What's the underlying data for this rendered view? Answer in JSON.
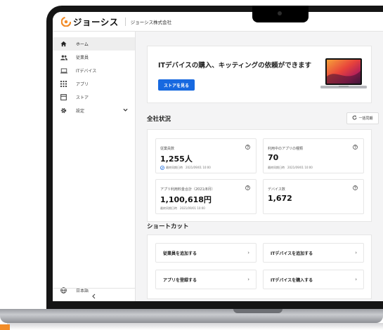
{
  "header": {
    "logo_text": "ジョーシス",
    "company_name": "ジョーシス株式会社"
  },
  "sidebar": {
    "items": [
      {
        "label": "ホーム",
        "icon": "home-icon",
        "active": true
      },
      {
        "label": "従業員",
        "icon": "people-icon"
      },
      {
        "label": "ITデバイス",
        "icon": "laptop-icon"
      },
      {
        "label": "アプリ",
        "icon": "apps-grid-icon"
      },
      {
        "label": "ストア",
        "icon": "store-icon"
      },
      {
        "label": "設定",
        "icon": "gear-icon"
      }
    ],
    "language": "日本語",
    "collapse_icon": "chevron-left-icon"
  },
  "banner": {
    "title": "ITデバイスの購入、キッティングの依頼ができます",
    "button": "ストアを見る"
  },
  "overview": {
    "title": "全社状況",
    "sync_button": "一括同期",
    "cards": [
      {
        "label": "従業員数",
        "value": "1,255人",
        "sub": "最終同期日時　2021/09/01 10:00"
      },
      {
        "label": "利用中のアプリの種類",
        "value": "70",
        "sub": "最終同期日時　2021/09/01 10:00"
      },
      {
        "label": "アプリ利用料金合計（2021/8月）",
        "value": "1,100,618円",
        "sub": "最終同期日時　2021/09/01 10:00"
      },
      {
        "label": "デバイス数",
        "value": "1,672",
        "sub": ""
      }
    ]
  },
  "shortcuts": {
    "title": "ショートカット",
    "items": [
      {
        "label": "従業員を追加する"
      },
      {
        "label": "ITデバイスを追加する"
      },
      {
        "label": "アプリを登録する"
      },
      {
        "label": "ITデバイスを購入する"
      }
    ]
  },
  "colors": {
    "accent": "#1769e0",
    "logo_orange": "#f28c28"
  }
}
